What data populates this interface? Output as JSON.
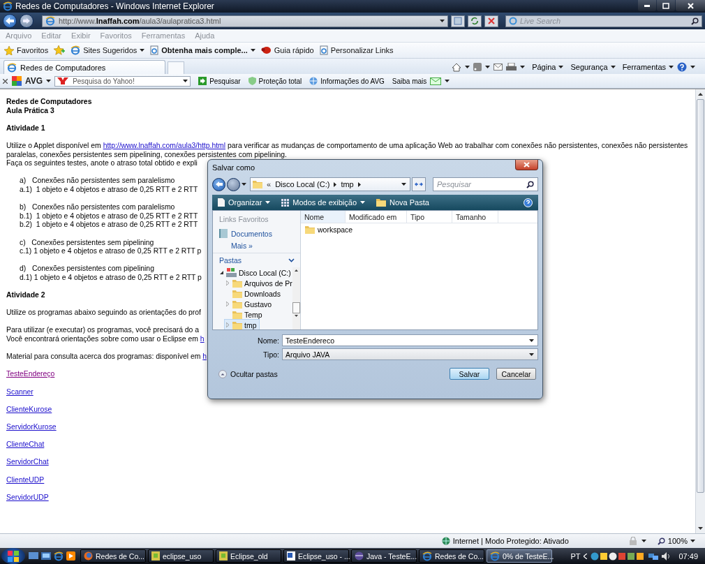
{
  "window": {
    "title": "Redes de Computadores - Windows Internet Explorer"
  },
  "address_bar": {
    "url": "http://www.**lnaffah.com**/aula3/aulapratica3.html"
  },
  "search_box": {
    "placeholder": "Live Search"
  },
  "menu_bar": [
    "Arquivo",
    "Editar",
    "Exibir",
    "Favoritos",
    "Ferramentas",
    "Ajuda"
  ],
  "favorites_bar": [
    {
      "label": "Favoritos",
      "dropdown": false,
      "bold": false
    },
    {
      "label": "Sites Sugeridos",
      "dropdown": true,
      "bold": false
    },
    {
      "label": "Obtenha mais comple...",
      "dropdown": true,
      "bold": true
    },
    {
      "label": "Guia rápido",
      "dropdown": false,
      "bold": false
    },
    {
      "label": "Personalizar Links",
      "dropdown": false,
      "bold": false
    }
  ],
  "tabs": [
    {
      "label": "Redes de Computadores",
      "selected": true
    }
  ],
  "command_bar": [
    "Página",
    "Segurança",
    "Ferramentas"
  ],
  "avg_toolbar": {
    "brand": "AVG",
    "search_placeholder": "Pesquisa do Yahoo!",
    "buttons": [
      "Pesquisar",
      "Proteção total",
      "Informações do AVG",
      "Saiba mais"
    ]
  },
  "page": {
    "blocks": [
      {
        "kind": "heading",
        "lines": [
          [
            {
              "text": "Redes de Computadores",
              "link": false
            }
          ],
          [
            {
              "text": "Aula Prática 3",
              "link": false
            }
          ]
        ]
      },
      {
        "kind": "heading",
        "lines": [
          [
            {
              "text": "Atividade 1",
              "link": false
            }
          ]
        ]
      },
      {
        "kind": "text",
        "lines": [
          [
            {
              "text": "Utilize o Applet disponível em ",
              "link": false
            },
            {
              "text": "http://www.lnaffah.com/aula3/http.html",
              "link": true
            },
            {
              "text": " para verificar as mudanças de comportamento de uma aplicação Web ao trabalhar com conexões não persistentes, conexões não persistentes",
              "link": false
            }
          ],
          [
            {
              "text": "paralelas, conexões persistentes sem pipelining, conexões persistentes com pipelining.",
              "link": false
            }
          ],
          [
            {
              "text": "Faça os seguintes testes, anote o atraso total obtido e expli",
              "link": false
            }
          ]
        ]
      },
      {
        "kind": "indented",
        "lines": [
          [
            {
              "text": "a)   Conexões não persistentes sem paralelismo",
              "link": false
            }
          ],
          [
            {
              "text": "a.1)  1 objeto e 4 objetos e atraso de 0,25 RTT e 2 RTT",
              "link": false
            }
          ]
        ]
      },
      {
        "kind": "indented",
        "lines": [
          [
            {
              "text": "b)   Conexões não persistentes com paralelismo",
              "link": false
            }
          ],
          [
            {
              "text": "b.1)  1 objeto e 4 objetos e atraso de 0,25 RTT e 2 RTT",
              "link": false
            }
          ],
          [
            {
              "text": "b.2)  1 objeto e 4 objetos e atraso de 0,25 RTT e 2 RTT",
              "link": false
            }
          ]
        ]
      },
      {
        "kind": "indented",
        "lines": [
          [
            {
              "text": "c)   Conexões persistentes sem pipelining",
              "link": false
            }
          ],
          [
            {
              "text": "c.1) 1 objeto e 4 objetos e atraso de 0,25 RTT e 2 RTT p",
              "link": false
            }
          ]
        ]
      },
      {
        "kind": "indented",
        "lines": [
          [
            {
              "text": "d)   Conexões persistentes com pipelining",
              "link": false
            }
          ],
          [
            {
              "text": "d.1) 1 objeto e 4 objetos e atraso de 0,25 RTT e 2 RTT p",
              "link": false
            }
          ]
        ]
      },
      {
        "kind": "heading",
        "lines": [
          [
            {
              "text": "Atividade 2",
              "link": false
            }
          ]
        ]
      },
      {
        "kind": "text",
        "lines": [
          [
            {
              "text": "Utilize os programas abaixo seguindo as orientações do prof",
              "link": false
            }
          ]
        ]
      },
      {
        "kind": "text",
        "lines": [
          [
            {
              "text": "Para utilizar (e executar) os programas, você precisará do a",
              "link": false
            }
          ],
          [
            {
              "text": "Você encontrará orientações sobre como usar o Eclipse em ",
              "link": false
            },
            {
              "text": "h",
              "link": true
            }
          ]
        ]
      },
      {
        "kind": "text",
        "lines": [
          [
            {
              "text": "Material para consulta acerca dos programas: disponível em ",
              "link": false
            },
            {
              "text": "h",
              "link": true
            }
          ]
        ]
      }
    ],
    "links": [
      {
        "text": "TesteEndereço",
        "visited": true
      },
      {
        "text": "Scanner",
        "visited": false
      },
      {
        "text": "ClienteKurose",
        "visited": false
      },
      {
        "text": "ServidorKurose",
        "visited": false
      },
      {
        "text": "ClienteChat",
        "visited": false
      },
      {
        "text": "ServidorChat",
        "visited": false
      },
      {
        "text": "ClienteUDP",
        "visited": false
      },
      {
        "text": "ServidorUDP",
        "visited": false
      }
    ]
  },
  "dialog": {
    "title": "Salvar como",
    "breadcrumb": [
      "«",
      "Disco Local (C:)",
      "tmp"
    ],
    "search_placeholder": "Pesquisar",
    "toolbar": [
      {
        "label": "Organizar",
        "dropdown": true
      },
      {
        "label": "Modos de exibição",
        "dropdown": true
      },
      {
        "label": "Nova Pasta",
        "dropdown": false
      }
    ],
    "favorite_links": {
      "heading": "Links Favoritos",
      "items": [
        "Documentos"
      ],
      "more": "Mais »"
    },
    "folders": {
      "heading": "Pastas",
      "tree": [
        {
          "label": "Disco Local (C:)",
          "kind": "drive",
          "selected": false,
          "children": [
            {
              "label": "Arquivos de Pr",
              "kind": "branch",
              "selected": false
            },
            {
              "label": "Downloads",
              "kind": "folder",
              "selected": false
            },
            {
              "label": "Gustavo",
              "kind": "branch",
              "selected": false
            },
            {
              "label": "Temp",
              "kind": "folder",
              "selected": false
            },
            {
              "label": "tmp",
              "kind": "branch",
              "selected": true
            }
          ]
        }
      ]
    },
    "columns": [
      "Nome",
      "Modificado em",
      "Tipo",
      "Tamanho"
    ],
    "files": [
      "workspace"
    ],
    "name_field": {
      "label": "Nome:",
      "value": "TesteEndereco"
    },
    "type_field": {
      "label": "Tipo:",
      "value": "Arquivo JAVA"
    },
    "hide_folders": "Ocultar pastas",
    "buttons": [
      {
        "label": "Salvar",
        "default": true
      },
      {
        "label": "Cancelar",
        "default": false
      }
    ]
  },
  "status_bar": {
    "zone": "Internet | Modo Protegido: Ativado",
    "zoom": "100%"
  },
  "taskbar": {
    "items": [
      {
        "label": "Redes de Co...",
        "selected": false
      },
      {
        "label": "eclipse_uso",
        "selected": false
      },
      {
        "label": "Eclipse_old",
        "selected": false
      },
      {
        "label": "Eclipse_uso - ...",
        "selected": false
      },
      {
        "label": "Java - TesteE...",
        "selected": false
      },
      {
        "label": "Redes de Co...",
        "selected": false
      },
      {
        "label": "0% de TesteE...",
        "selected": true
      }
    ],
    "language": "PT",
    "clock": "07:49"
  }
}
